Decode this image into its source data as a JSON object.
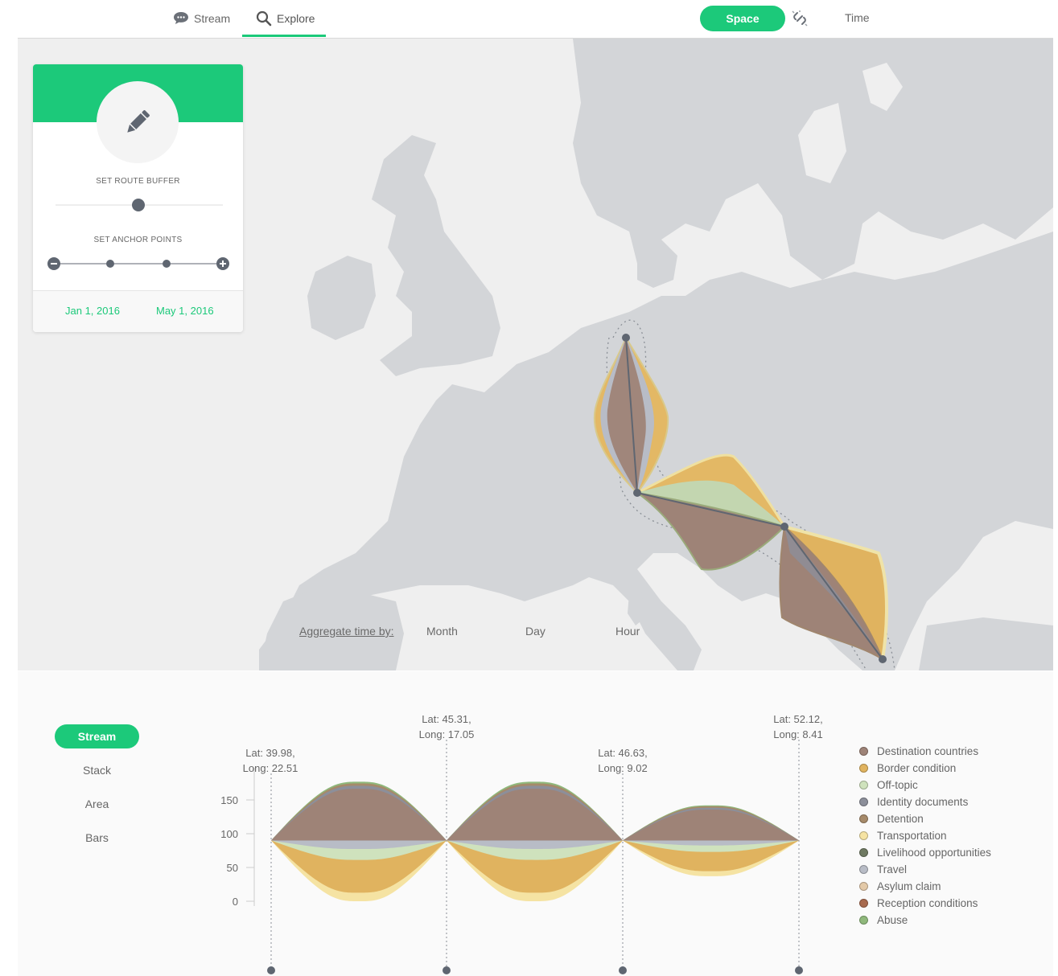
{
  "nav": {
    "stream_label": "Stream",
    "explore_label": "Explore",
    "space_label": "Space",
    "time_label": "Time"
  },
  "panel": {
    "buffer_label": "SET ROUTE BUFFER",
    "anchor_label": "SET ANCHOR POINTS",
    "start_date": "Jan 1, 2016",
    "end_date": "May 1, 2016"
  },
  "aggregate": {
    "label": "Aggregate time by:",
    "options": [
      "Month",
      "Day",
      "Hour"
    ]
  },
  "chart_modes": [
    "Stream",
    "Stack",
    "Area",
    "Bars"
  ],
  "anchors": [
    {
      "lat": "Lat: 39.98,",
      "long": "Long: 22.51"
    },
    {
      "lat": "Lat: 45.31,",
      "long": "Long: 17.05"
    },
    {
      "lat": "Lat: 46.63,",
      "long": "Long: 9.02"
    },
    {
      "lat": "Lat: 52.12,",
      "long": "Long: 8.41"
    }
  ],
  "colors": {
    "accent": "#1cc97a",
    "land": "#d3d5d8",
    "sea": "#efefef"
  },
  "chart_data": {
    "type": "area",
    "subtype": "streamgraph",
    "yticks": [
      0,
      50,
      100,
      150
    ],
    "ylim": [
      0,
      150
    ],
    "x": [
      0,
      1,
      2,
      3
    ],
    "baseline": 90,
    "segments": [
      {
        "peak_top": 177,
        "peak_bottom": 0
      },
      {
        "peak_top": 177,
        "peak_bottom": 0
      },
      {
        "peak_top": 142,
        "peak_bottom": 37
      }
    ],
    "series": [
      {
        "name": "Destination countries",
        "color": "#9e8377"
      },
      {
        "name": "Border condition",
        "color": "#e0b35f"
      },
      {
        "name": "Off-topic",
        "color": "#cfe2bd"
      },
      {
        "name": "Identity documents",
        "color": "#8c8f9a"
      },
      {
        "name": "Detention",
        "color": "#a68a6a"
      },
      {
        "name": "Transportation",
        "color": "#f5e3a3"
      },
      {
        "name": "Livelihood opportunities",
        "color": "#6f7a62"
      },
      {
        "name": "Travel",
        "color": "#b8bcc6"
      },
      {
        "name": "Asylum claim",
        "color": "#e3c9a8"
      },
      {
        "name": "Reception conditions",
        "color": "#a86a4e"
      },
      {
        "name": "Abuse",
        "color": "#8fb87b"
      }
    ],
    "grid": false,
    "legend_position": "right"
  }
}
